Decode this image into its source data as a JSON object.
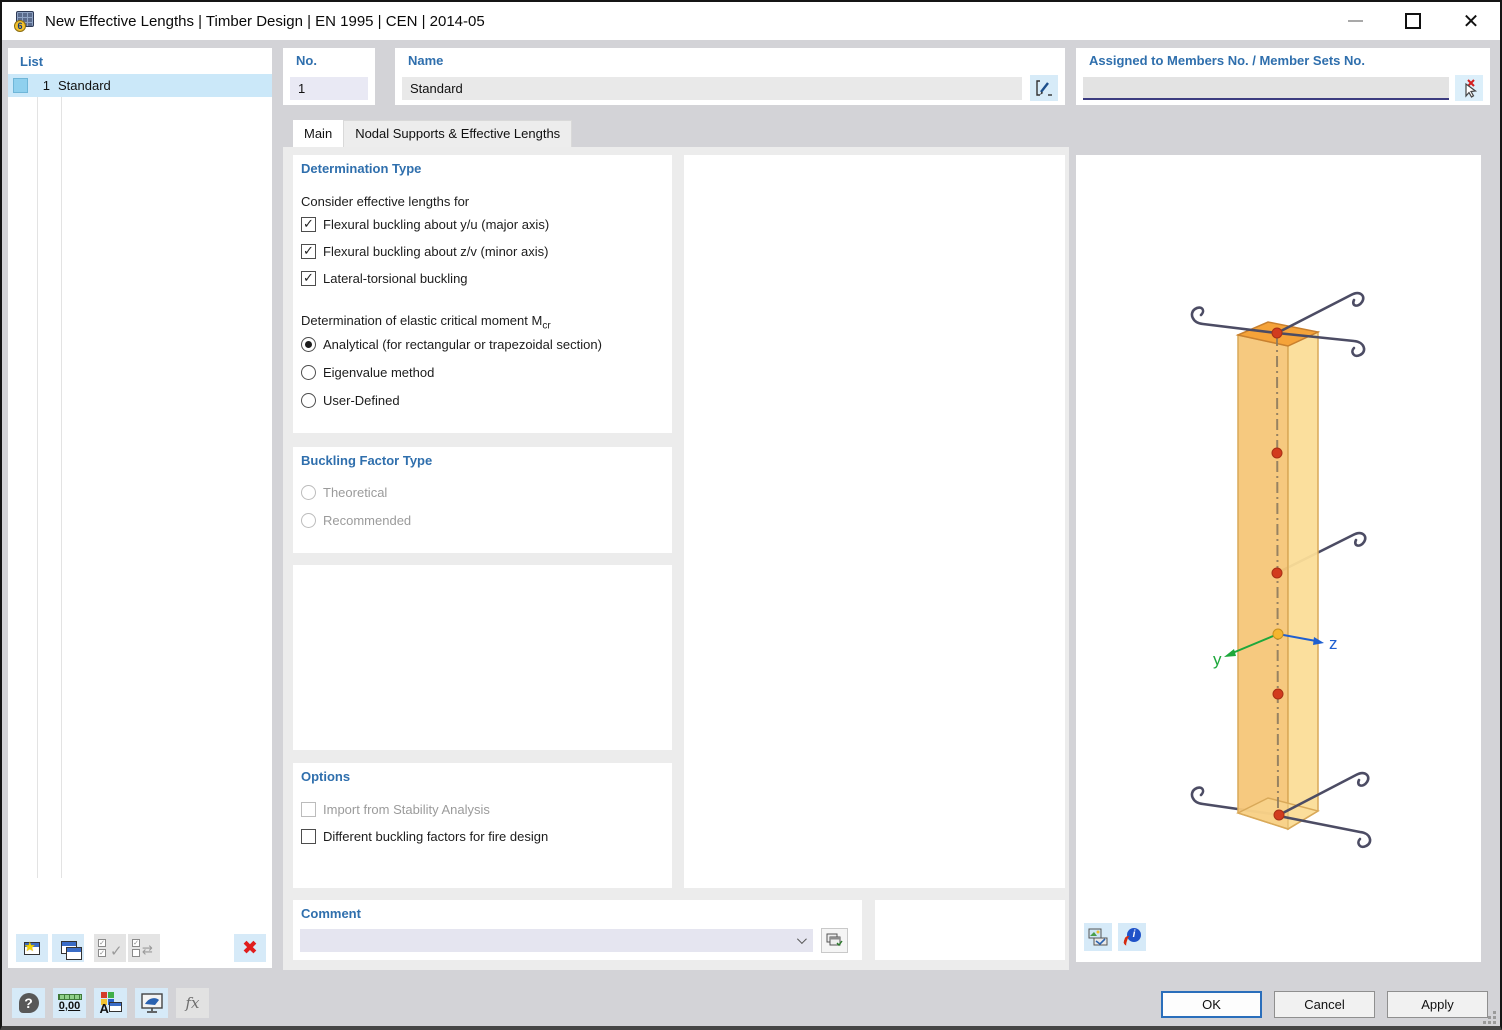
{
  "window": {
    "title": "New Effective Lengths | Timber Design | EN 1995 | CEN | 2014-05",
    "app_badge": "6"
  },
  "list_panel": {
    "header": "List",
    "items": [
      {
        "no": "1",
        "name": "Standard",
        "selected": true
      }
    ]
  },
  "header_fields": {
    "no_label": "No.",
    "no_value": "1",
    "name_label": "Name",
    "name_value": "Standard",
    "assigned_label": "Assigned to Members No. / Member Sets No.",
    "assigned_value": ""
  },
  "tabs": {
    "main": "Main",
    "nodal": "Nodal Supports & Effective Lengths"
  },
  "determination": {
    "header": "Determination Type",
    "consider_label": "Consider effective lengths for",
    "checks": [
      {
        "label": "Flexural buckling about y/u (major axis)",
        "checked": true
      },
      {
        "label": "Flexural buckling about z/v (minor axis)",
        "checked": true
      },
      {
        "label": "Lateral-torsional buckling",
        "checked": true
      }
    ],
    "moment_label": "Determination of elastic critical moment M",
    "moment_subscript": "cr",
    "radios": [
      {
        "label": "Analytical (for rectangular or trapezoidal section)",
        "selected": true
      },
      {
        "label": "Eigenvalue method",
        "selected": false
      },
      {
        "label": "User-Defined",
        "selected": false
      }
    ]
  },
  "buckling_factor": {
    "header": "Buckling Factor Type",
    "radios": [
      {
        "label": "Theoretical",
        "disabled": true,
        "selected": false
      },
      {
        "label": "Recommended",
        "disabled": true,
        "selected": false
      }
    ]
  },
  "options": {
    "header": "Options",
    "checks": [
      {
        "label": "Import from Stability Analysis",
        "checked": false,
        "disabled": true
      },
      {
        "label": "Different buckling factors for fire design",
        "checked": false,
        "disabled": false
      }
    ]
  },
  "comment": {
    "header": "Comment",
    "value": ""
  },
  "viz": {
    "axis_y_label": "y",
    "axis_z_label": "z",
    "info_letter": "i"
  },
  "footer": {
    "ok": "OK",
    "cancel": "Cancel",
    "apply": "Apply",
    "toolbar": {
      "help_text": "?",
      "units_text": "0,00",
      "font_letter": "A",
      "fx_text": "fx"
    }
  },
  "colors": {
    "header_blue": "#2f6fad",
    "selection_blue": "#cbe8f9",
    "button_blue_bg": "#d6eaf8",
    "ok_border": "#2a6ebb",
    "assigned_underline": "#3c3c80",
    "column_front": "#f6c678",
    "column_side": "#fbdd98",
    "column_top": "#f5a339",
    "support_line": "#4c4c64",
    "node_red": "#d23b1e",
    "node_yellow": "#f5b52e",
    "axis_y_green": "#1ea83c",
    "axis_z_blue": "#1f5fd0"
  }
}
